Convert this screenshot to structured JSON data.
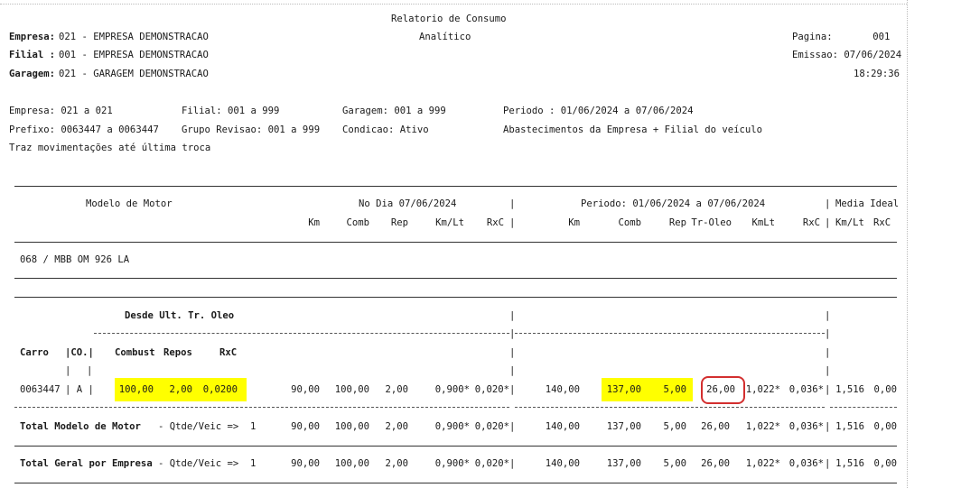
{
  "header": {
    "title": "Relatorio de Consumo",
    "subtitle": "Analítico",
    "empresa_label": "Empresa:",
    "empresa_value": "021 - EMPRESA DEMONSTRACAO",
    "filial_label": "Filial :",
    "filial_value": "001 - EMPRESA DEMONSTRACAO",
    "garagem_label": "Garagem:",
    "garagem_value": "021 - GARAGEM DEMONSTRACAO",
    "pagina": "Pagina:       001",
    "emissao": "Emissao: 07/06/2024",
    "hora": "18:29:36"
  },
  "filters": {
    "line1": {
      "empresa": "Empresa: 021 a 021",
      "filial": "Filial: 001 a 999",
      "garagem": "Garagem: 001 a 999",
      "periodo": "Periodo : 01/06/2024 a 07/06/2024"
    },
    "line2": {
      "prefixo": "Prefixo: 0063447 a 0063447",
      "grupo": "Grupo Revisao: 001 a 999",
      "condicao": "Condicao: Ativo",
      "abastecimentos": "Abastecimentos da Empresa + Filial do veículo"
    },
    "line3": "Traz movimentações até última troca"
  },
  "table_header": {
    "modelo_motor": "Modelo de Motor",
    "no_dia": "No Dia 07/06/2024",
    "periodo": "Periodo: 01/06/2024 a 07/06/2024",
    "media_ideal": "Media Ideal",
    "cols_dia": [
      "Km",
      "Comb",
      "Rep",
      "Km/Lt",
      "RxC"
    ],
    "cols_periodo": [
      "Km",
      "Comb",
      "Rep",
      "Tr-Oleo",
      "KmLt",
      "RxC"
    ],
    "cols_media": [
      "Km/Lt",
      "RxC"
    ]
  },
  "group": {
    "label": "068 / MBB OM 926 LA"
  },
  "subheader": {
    "desde": "Desde Ult. Tr. Oleo",
    "carro": "Carro",
    "co": "|CO.|",
    "combust": "Combust",
    "repos": "Repos",
    "rxc": "RxC"
  },
  "row": {
    "carro": "0063447",
    "co": "| A |",
    "combust": "100,00",
    "repos": "2,00",
    "rxc": "0,0200",
    "dia_km": "90,00",
    "dia_comb": "100,00",
    "dia_rep": "2,00",
    "dia_kmlt": "0,900*",
    "dia_rxc": "0,020*",
    "per_km": "140,00",
    "per_comb": "137,00",
    "per_rep": "5,00",
    "per_troleo": "26,00",
    "per_kmlt": "1,022*",
    "per_rxc": "0,036*",
    "media_kmlt": "1,516",
    "media_rxc": "0,00"
  },
  "total_modelo": {
    "label": "Total Modelo de Motor",
    "qtde": "- Qtde/Veic =>  1",
    "dia_km": "90,00",
    "dia_comb": "100,00",
    "dia_rep": "2,00",
    "dia_kmlt": "0,900*",
    "dia_rxc": "0,020*",
    "per_km": "140,00",
    "per_comb": "137,00",
    "per_rep": "5,00",
    "per_troleo": "26,00",
    "per_kmlt": "1,022*",
    "per_rxc": "0,036*",
    "media_kmlt": "1,516",
    "media_rxc": "0,00"
  },
  "total_geral": {
    "label": "Total Geral por Empresa",
    "qtde": "- Qtde/Veic =>  1",
    "dia_km": "90,00",
    "dia_comb": "100,00",
    "dia_rep": "2,00",
    "dia_kmlt": "0,900*",
    "dia_rxc": "0,020*",
    "per_km": "140,00",
    "per_comb": "137,00",
    "per_rep": "5,00",
    "per_troleo": "26,00",
    "per_kmlt": "1,022*",
    "per_rxc": "0,036*",
    "media_kmlt": "1,516",
    "media_rxc": "0,00"
  },
  "colors": {
    "highlight": "#ffff00",
    "circle": "#d32f2f"
  }
}
